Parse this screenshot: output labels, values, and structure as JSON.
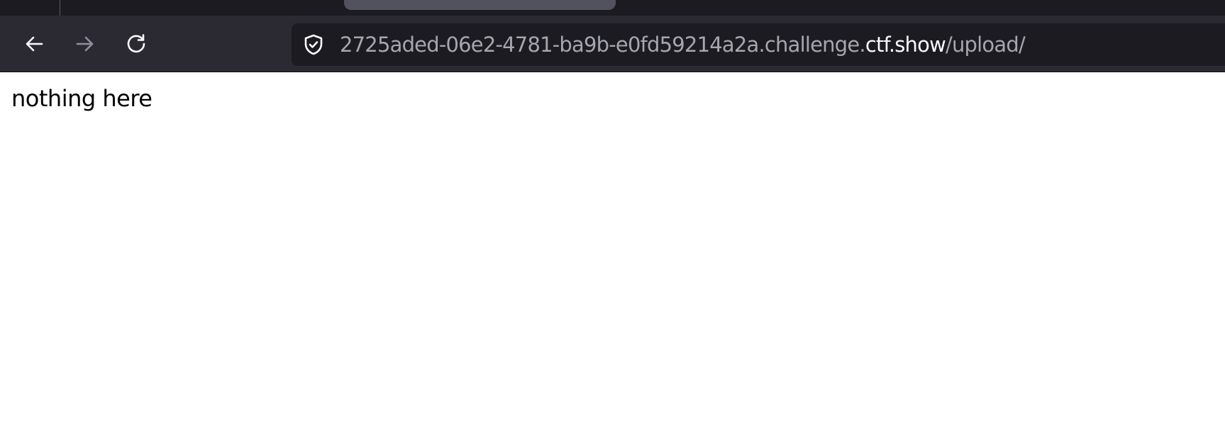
{
  "browser": {
    "url": {
      "prefix": "2725aded-06e2-4781-ba9b-e0fd59214a2a.challenge.",
      "domain": "ctf.show",
      "path": "/upload/"
    },
    "icons": {
      "back": "arrow-left-icon",
      "forward": "arrow-right-icon",
      "reload": "reload-icon",
      "security": "shield-check-icon"
    },
    "colors": {
      "toolbar": "#2b2a33",
      "tabstrip": "#1c1b22",
      "urlbar": "#1c1b22",
      "url_dim": "#a6a6b0",
      "url_host": "#fbfbfe",
      "forward_disabled": "#8f8f9d"
    },
    "forward_enabled": false
  },
  "page": {
    "text": "nothing here"
  }
}
